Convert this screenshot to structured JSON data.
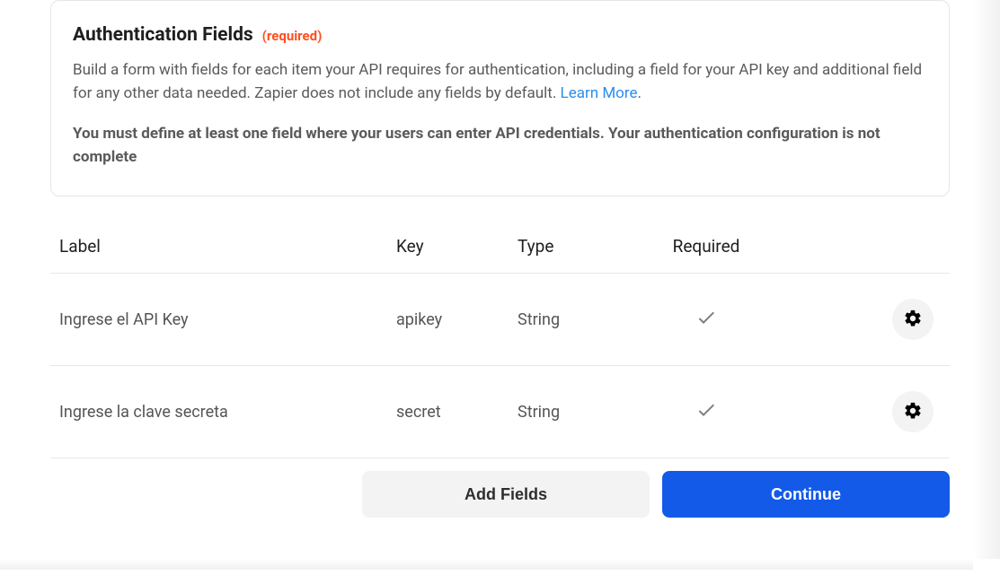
{
  "panel": {
    "title": "Authentication Fields",
    "required_badge": "(required)",
    "description_pre": "Build a form with fields for each item your API requires for authentication, including a field for your API key and additional field for any other data needed. Zapier does not include any fields by default. ",
    "learn_more": "Learn More",
    "description_post": ".",
    "warning": "You must define at least one field where your users can enter API credentials. Your authentication configuration is not complete"
  },
  "table": {
    "headers": {
      "label": "Label",
      "key": "Key",
      "type": "Type",
      "required": "Required"
    },
    "rows": [
      {
        "label": "Ingrese el API Key",
        "key": "apikey",
        "type": "String",
        "required": true
      },
      {
        "label": "Ingrese la clave secreta",
        "key": "secret",
        "type": "String",
        "required": true
      }
    ]
  },
  "buttons": {
    "add_fields": "Add Fields",
    "continue": "Continue"
  }
}
